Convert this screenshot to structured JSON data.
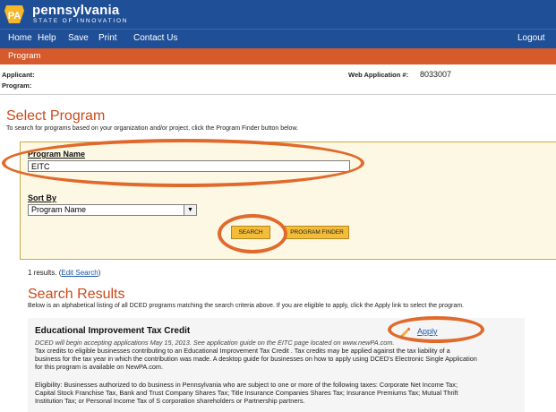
{
  "header": {
    "logo_badge": "PA",
    "logo_title": "pennsylvania",
    "logo_subtitle": "STATE OF INNOVATION",
    "nav": [
      "Home",
      "Help",
      "Save",
      "Print",
      "Contact Us"
    ],
    "logout": "Logout",
    "section": "Program"
  },
  "info": {
    "applicant_label": "Applicant:",
    "program_label": "Program:",
    "web_app_label": "Web Application #:",
    "web_app_value": "8033007"
  },
  "select_program": {
    "title": "Select Program",
    "description": "To search for programs based on your organization and/or project, click the Program Finder button below.",
    "program_name_label": "Program Name",
    "program_name_value": "EITC",
    "sort_by_label": "Sort By",
    "sort_by_value": "Program Name",
    "search_button": "SEARCH",
    "finder_button": "PROGRAM FINDER"
  },
  "results": {
    "count_text": "1 results.",
    "edit_search": "Edit Search",
    "title": "Search Results",
    "description": "Below is an alphabetical listing of all DCED programs matching the search criteria above.  If you are eligible to apply, click the Apply link to select the program.",
    "item": {
      "title": "Educational Improvement Tax Credit",
      "apply": "Apply",
      "note": "DCED will begin accepting applications May 15, 2013. See application guide on the EITC page located on www.newPA.com.",
      "body_lines": [
        "Tax credits to eligible businesses contributing to an Educational Improvement Tax Credit . Tax credits may be applied against the tax liability of a",
        "business for the tax year in which the contribution was made. A desktop guide for businesses on how to apply using DCED's Electronic Single Application",
        "for this program is available on NewPA.com."
      ],
      "eligibility_lines": [
        "Eligibility: Businesses authorized to do business in Pennsylvania who are subject to one or more of the following taxes: Corporate Net Income Tax;",
        "Capital Stock Franchise Tax, Bank and Trust Company Shares Tax; Title Insurance Companies Shares Tax; Insurance Premiums Tax; Mutual Thrift",
        "Institution Tax; or Personal Income Tax of S corporation shareholders or Partnership partners."
      ]
    }
  },
  "colors": {
    "banner": "#1f4f96",
    "section": "#d65a2c",
    "title": "#cc4a1a",
    "highlight": "#e06a2c",
    "button": "#f3bd3a",
    "link": "#1b55a6"
  }
}
